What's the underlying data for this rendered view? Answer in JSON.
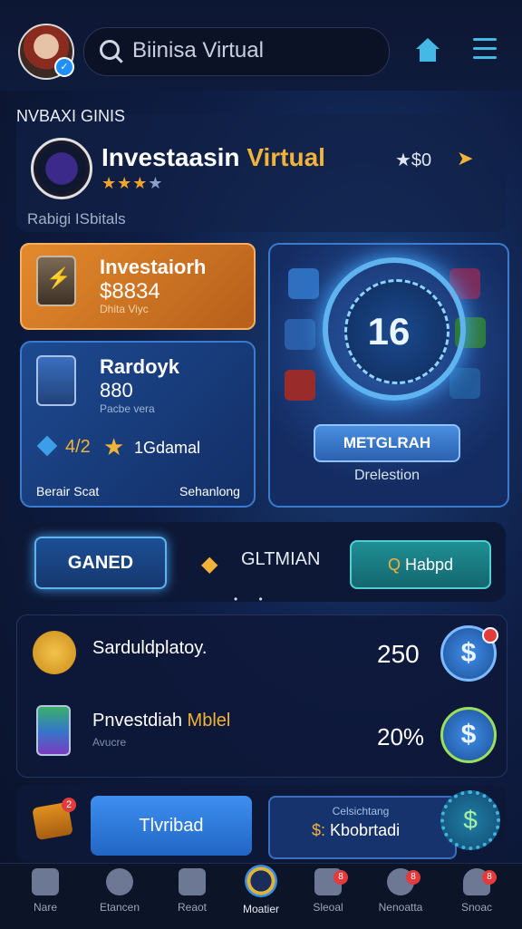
{
  "header": {
    "search_text": "Biinisa Virtual"
  },
  "section": {
    "title": "NVBAXI GINIS"
  },
  "profile": {
    "name": "Investaasin",
    "name_accent": "Virtual",
    "stars_filled": "★★★",
    "stars_empty": "★",
    "rating": "★$0",
    "sub_label": "Rabigi ISbitals"
  },
  "cards": {
    "orange": {
      "title": "Investaiorh",
      "value": "$8834",
      "sub": "Dhita Viyc"
    },
    "blue": {
      "title": "Rardoyk",
      "value": "880",
      "sub": "Pacbe vera",
      "count": "4/2",
      "gold_label": "1Gdamal",
      "footer_left": "Berair Scat",
      "footer_right": "Sehanlong"
    }
  },
  "dial": {
    "number": "16",
    "button_label": "METGLRAH",
    "caption": "Drelestion"
  },
  "tabs": {
    "gamed": "GANED",
    "middle": "GLTMIAN",
    "help_icon": "Q",
    "help": "Habpd",
    "dots": "• •"
  },
  "list": [
    {
      "label": "Sarduldplatoy.",
      "value": "250"
    },
    {
      "label": "Pnvestdiah",
      "label_accent": "Mblel",
      "sub": "Avucre",
      "value": "20%"
    }
  ],
  "bottom": {
    "chest_badge": "2",
    "btn_primary": "Tlvribad",
    "btn_outline_top": "Celsichtang",
    "btn_outline_main": "Kbobrtadi",
    "btn_outline_acc": "$:"
  },
  "nav": [
    {
      "label": "Nare",
      "icon": "home-icon"
    },
    {
      "label": "Etancen",
      "icon": "search-icon"
    },
    {
      "label": "Reaot",
      "icon": "document-icon"
    },
    {
      "label": "Moatier",
      "icon": "target-icon"
    },
    {
      "label": "Sleoal",
      "icon": "clipboard-icon",
      "badge": "8"
    },
    {
      "label": "Nenoatta",
      "icon": "cancel-icon",
      "badge": "8"
    },
    {
      "label": "Snoac",
      "icon": "user-icon",
      "badge": "8"
    }
  ]
}
